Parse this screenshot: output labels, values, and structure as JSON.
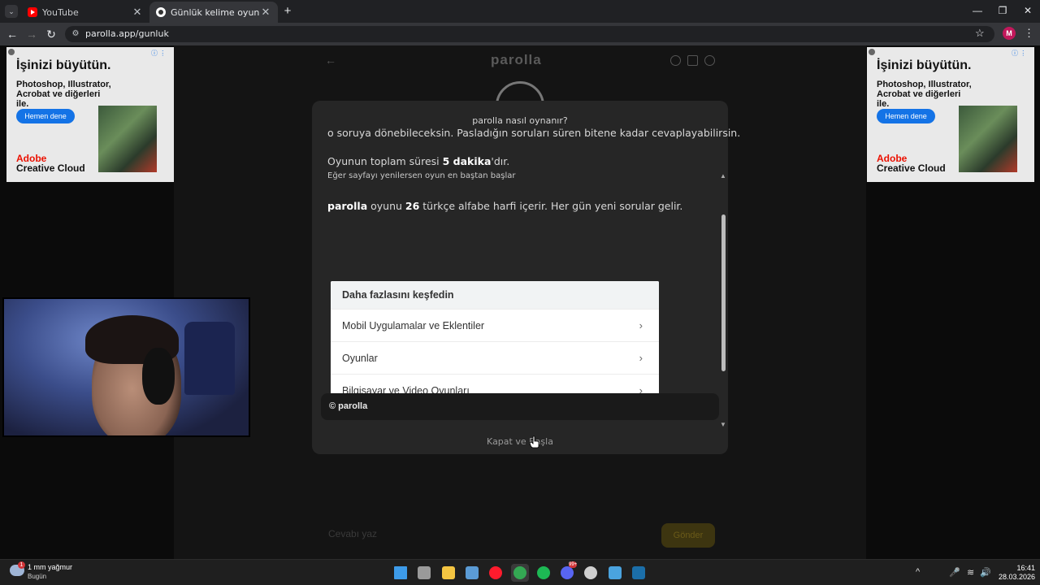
{
  "browser": {
    "tabs": [
      {
        "title": "YouTube",
        "active": false
      },
      {
        "title": "Günlük kelime oyunu - parolla",
        "active": true
      }
    ],
    "url": "parolla.app/gunluk",
    "profile_initial": "M",
    "icons": {
      "back": "←",
      "forward": "→",
      "reload": "↻",
      "new_tab": "+",
      "close": "✕",
      "star": "☆",
      "menu": "⋮",
      "minimize": "—",
      "restore": "❐",
      "window_close": "✕",
      "tab_list": "⌄",
      "site_info": "⚙"
    }
  },
  "ads": {
    "headline": "İşinizi büyütün.",
    "subline": "Photoshop, Illustrator, Acrobat ve diğerleri ile.",
    "cta": "Hemen dene",
    "brand_line1": "Adobe",
    "brand_line2": "Creative Cloud",
    "info": "ⓘ ⋮"
  },
  "app": {
    "logo": "parolla",
    "back_icon": "←",
    "input_placeholder": "Cevabı yaz",
    "send_label": "Gönder"
  },
  "modal": {
    "title": "parolla nasıl oynanır?",
    "line_partial": "o soruya dönebileceksin. Pasladığın soruları süren bitene kadar cevaplayabilirsin.",
    "duration_prefix": "Oyunun toplam süresi ",
    "duration_value": "5 dakika",
    "duration_suffix": "'dır.",
    "refresh_note": "Eğer sayfayı yenilersen oyun en baştan başlar",
    "letters_brand": "parolla",
    "letters_mid": " oyunu ",
    "letters_count": "26",
    "letters_suffix": " türkçe alfabe harfi içerir. Her gün yeni sorular gelir.",
    "discover": {
      "heading": "Daha fazlasını keşfedin",
      "items": [
        {
          "label": "Mobil Uygulamalar ve Eklentiler"
        },
        {
          "label": "Oyunlar"
        },
        {
          "label": "Bilgisayar ve Video Oyunları"
        }
      ],
      "chevron": "›"
    },
    "footer": "© parolla",
    "close_button": "Kapat ve Başla",
    "scroll_up": "▲",
    "scroll_down": "▼"
  },
  "taskbar": {
    "weather_temp": "1 mm yağmur",
    "weather_day": "Bugün",
    "weather_badge": "1",
    "apps": [
      {
        "name": "start",
        "color": "#3d9be9",
        "active": false
      },
      {
        "name": "task-view",
        "color": "#9a9a9a",
        "active": false
      },
      {
        "name": "file-explorer",
        "color": "#f4c542",
        "active": false
      },
      {
        "name": "microsoft-store",
        "color": "#5b9bd5",
        "active": false
      },
      {
        "name": "opera",
        "color": "#ff1b2d",
        "active": false
      },
      {
        "name": "chrome",
        "color": "#34a853",
        "active": true
      },
      {
        "name": "spotify",
        "color": "#1db954",
        "active": false
      },
      {
        "name": "discord",
        "color": "#5865f2",
        "active": false
      },
      {
        "name": "obs-studio",
        "color": "#cfcfcf",
        "active": false
      },
      {
        "name": "photos",
        "color": "#4aa3df",
        "active": false
      },
      {
        "name": "steam",
        "color": "#1b6ea8",
        "active": false
      }
    ],
    "discord_badge": "99+",
    "time": "16:41",
    "date": "28.03.2026",
    "tray_icons": {
      "chevron": "^",
      "mic": "🎤",
      "wifi": "≋",
      "volume": "🔊"
    }
  }
}
